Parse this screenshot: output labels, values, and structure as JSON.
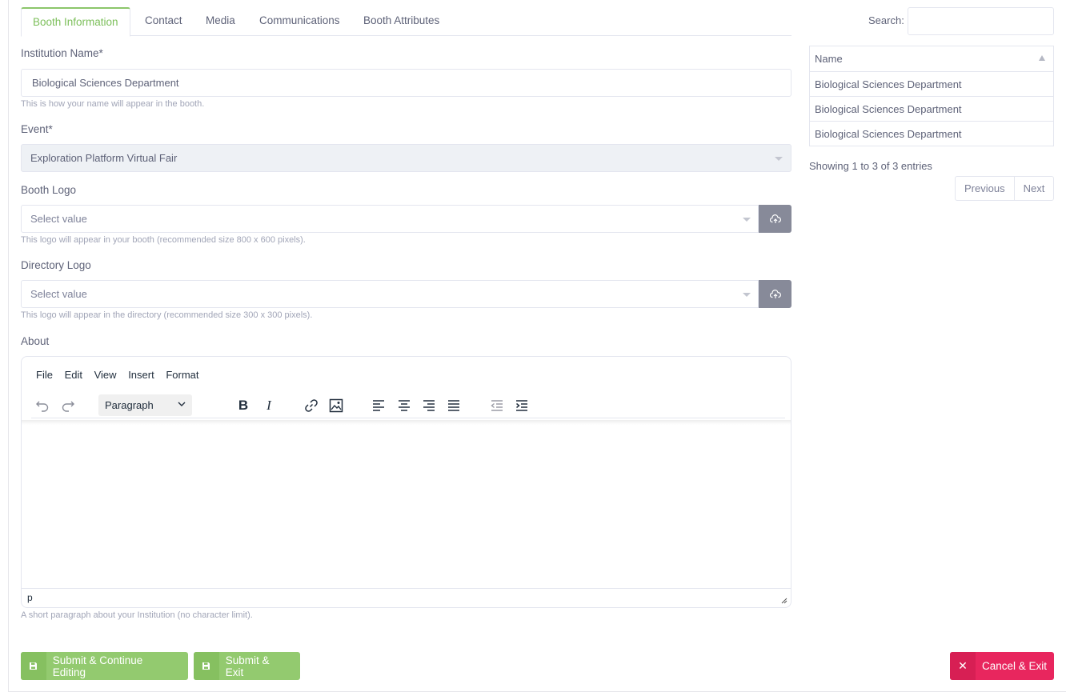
{
  "tabs": [
    "Booth Information",
    "Contact",
    "Media",
    "Communications",
    "Booth Attributes"
  ],
  "form": {
    "institution": {
      "label": "Institution Name*",
      "value": "Biological Sciences Department",
      "help": "This is how your name will appear in the booth."
    },
    "event": {
      "label": "Event*",
      "value": "Exploration Platform Virtual Fair"
    },
    "booth_logo": {
      "label": "Booth Logo",
      "placeholder": "Select value",
      "help": "This logo will appear in your booth (recommended size 800 x 600 pixels)."
    },
    "directory_logo": {
      "label": "Directory Logo",
      "placeholder": "Select value",
      "help": "This logo will appear in the directory (recommended size 300 x 300 pixels)."
    },
    "about": {
      "label": "About",
      "help": "A short paragraph about your Institution (no character limit).",
      "menu": [
        "File",
        "Edit",
        "View",
        "Insert",
        "Format"
      ],
      "block_format": "Paragraph",
      "status_path": "p"
    }
  },
  "buttons": {
    "submit_continue": "Submit & Continue Editing",
    "submit_exit": "Submit & Exit",
    "cancel_exit": "Cancel & Exit"
  },
  "table": {
    "search_label": "Search:",
    "column": "Name",
    "rows": [
      "Biological Sciences Department",
      "Biological Sciences Department",
      "Biological Sciences Department"
    ],
    "info": "Showing 1 to 3 of 3 entries",
    "prev": "Previous",
    "next": "Next"
  },
  "colors": {
    "accent_green": "#93ca6f",
    "danger": "#e8265e"
  }
}
